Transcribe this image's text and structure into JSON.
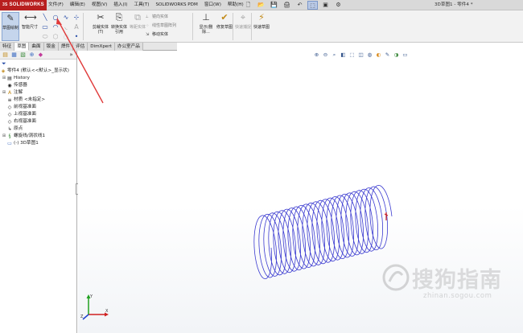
{
  "app": {
    "logo_prefix": "3S",
    "logo_text": "SOLIDWORKS",
    "document_title": "3D草图1 - 零件4 *"
  },
  "menu": [
    "文件(F)",
    "编辑(E)",
    "视图(V)",
    "插入(I)",
    "工具(T)",
    "SOLIDWORKS PDM",
    "窗口(W)",
    "帮助(H)"
  ],
  "quick_access": [
    "🗋",
    "📂",
    "💾",
    "🖨",
    "↶",
    "⬚",
    "▣",
    "⚙"
  ],
  "ribbon": {
    "sketch_button": "草图绘制",
    "smart_dimension": "智能尺寸",
    "trim": "剪裁实体(T)",
    "convert": "转换实体引用",
    "offset": "等距实体",
    "mirror": "镜向实体",
    "linear_pattern": "线性草图阵列",
    "move": "移动实体",
    "display_delete": "显示/删除...",
    "repair": "修复草图",
    "quick_snap": "快速捕捉",
    "rapid_sketch": "快速草图"
  },
  "tabs": [
    "特征",
    "草图",
    "曲面",
    "钣金",
    "焊件",
    "评估",
    "DimXpert",
    "办公室产品"
  ],
  "tree": {
    "root": "零件4 (默认<<默认>_显示状)",
    "items": [
      {
        "label": "History",
        "icon": "▤",
        "expandable": true
      },
      {
        "label": "传感器",
        "icon": "◉",
        "expandable": false
      },
      {
        "label": "注解",
        "icon": "A",
        "expandable": true
      },
      {
        "label": "材质 <未指定>",
        "icon": "≡",
        "expandable": false
      },
      {
        "label": "前视基准面",
        "icon": "◇",
        "expandable": false
      },
      {
        "label": "上视基准面",
        "icon": "◇",
        "expandable": false
      },
      {
        "label": "右视基准面",
        "icon": "◇",
        "expandable": false
      },
      {
        "label": "原点",
        "icon": "↳",
        "expandable": false
      },
      {
        "label": "螺旋线/涡状线1",
        "icon": "§",
        "expandable": true
      },
      {
        "label": "(-) 3D草图1",
        "icon": "▭",
        "expandable": false
      }
    ]
  },
  "hud": [
    "⊕",
    "⊖",
    "⌕",
    "◧",
    "⬚",
    "◫",
    "◍",
    "◐",
    "✎",
    "◑",
    "▭"
  ],
  "triad": {
    "x": "X",
    "y": "Y",
    "z": "Z"
  },
  "watermark": {
    "text": "搜狗指南",
    "url": "zhinan.sogou.com"
  },
  "colors": {
    "helix": "#3a3ad0",
    "annotation_arrow": "#e03a3a",
    "logo_bg": "#b81f1f",
    "highlight": "#c5d5ec"
  },
  "helix": {
    "turns": 25
  }
}
